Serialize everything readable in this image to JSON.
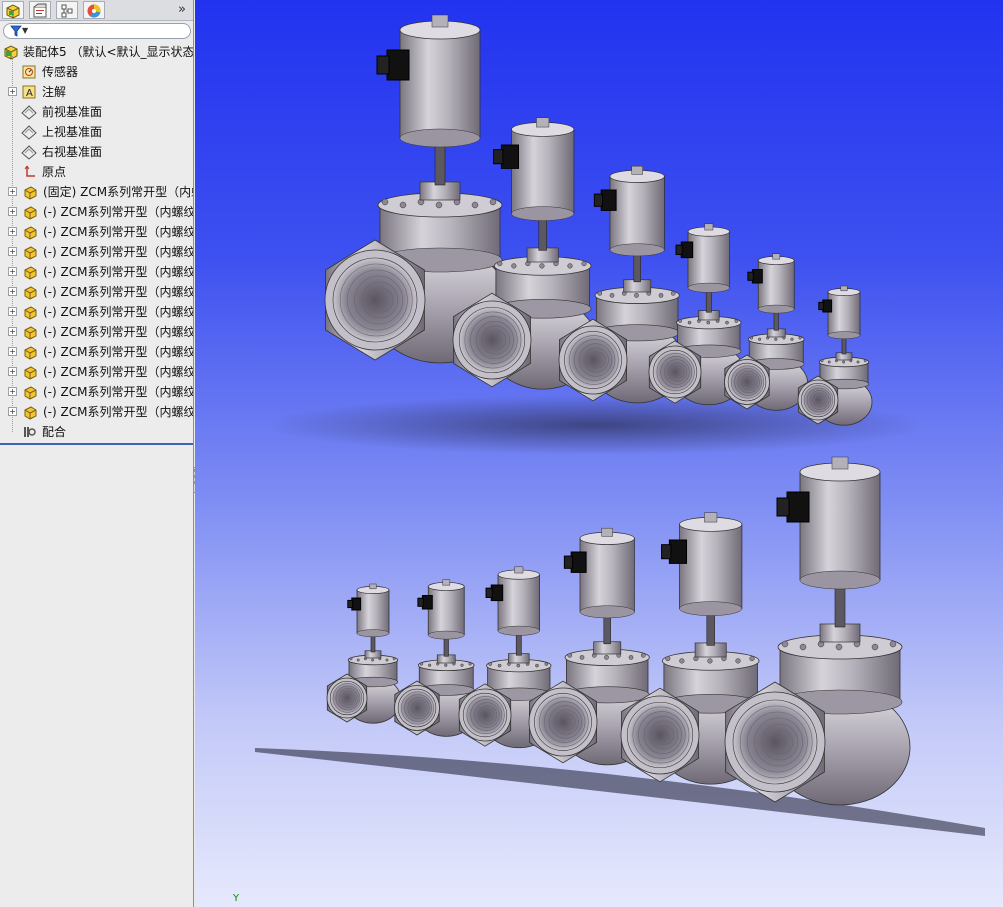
{
  "feature_tree": {
    "root_label": "装配体5 （默认<默认_显示状态-",
    "items": [
      {
        "label": "传感器",
        "icon": "sensor-icon"
      },
      {
        "label": "注解",
        "icon": "annotation-icon"
      },
      {
        "label": "前视基准面",
        "icon": "plane-icon"
      },
      {
        "label": "上视基准面",
        "icon": "plane-icon"
      },
      {
        "label": "右视基准面",
        "icon": "plane-icon"
      },
      {
        "label": "原点",
        "icon": "origin-icon"
      },
      {
        "label": "(固定) ZCM系列常开型（内螺",
        "icon": "part-icon"
      },
      {
        "label": "(-) ZCM系列常开型（内螺纹",
        "icon": "part-icon"
      },
      {
        "label": "(-) ZCM系列常开型（内螺纹",
        "icon": "part-icon"
      },
      {
        "label": "(-) ZCM系列常开型（内螺纹",
        "icon": "part-icon"
      },
      {
        "label": "(-) ZCM系列常开型（内螺纹",
        "icon": "part-icon"
      },
      {
        "label": "(-) ZCM系列常开型（内螺纹",
        "icon": "part-icon"
      },
      {
        "label": "(-) ZCM系列常开型（内螺纹",
        "icon": "part-icon"
      },
      {
        "label": "(-) ZCM系列常开型（内螺纹",
        "icon": "part-icon"
      },
      {
        "label": "(-) ZCM系列常开型（内螺纹",
        "icon": "part-icon"
      },
      {
        "label": "(-) ZCM系列常开型（内螺纹",
        "icon": "part-icon"
      },
      {
        "label": "(-) ZCM系列常开型（内螺纹",
        "icon": "part-icon"
      },
      {
        "label": "(-) ZCM系列常开型（内螺纹",
        "icon": "part-icon"
      },
      {
        "label": "配合",
        "icon": "mates-icon"
      }
    ]
  },
  "tabs": {
    "more": "»"
  },
  "viewport": {
    "axis_label": "Y"
  }
}
